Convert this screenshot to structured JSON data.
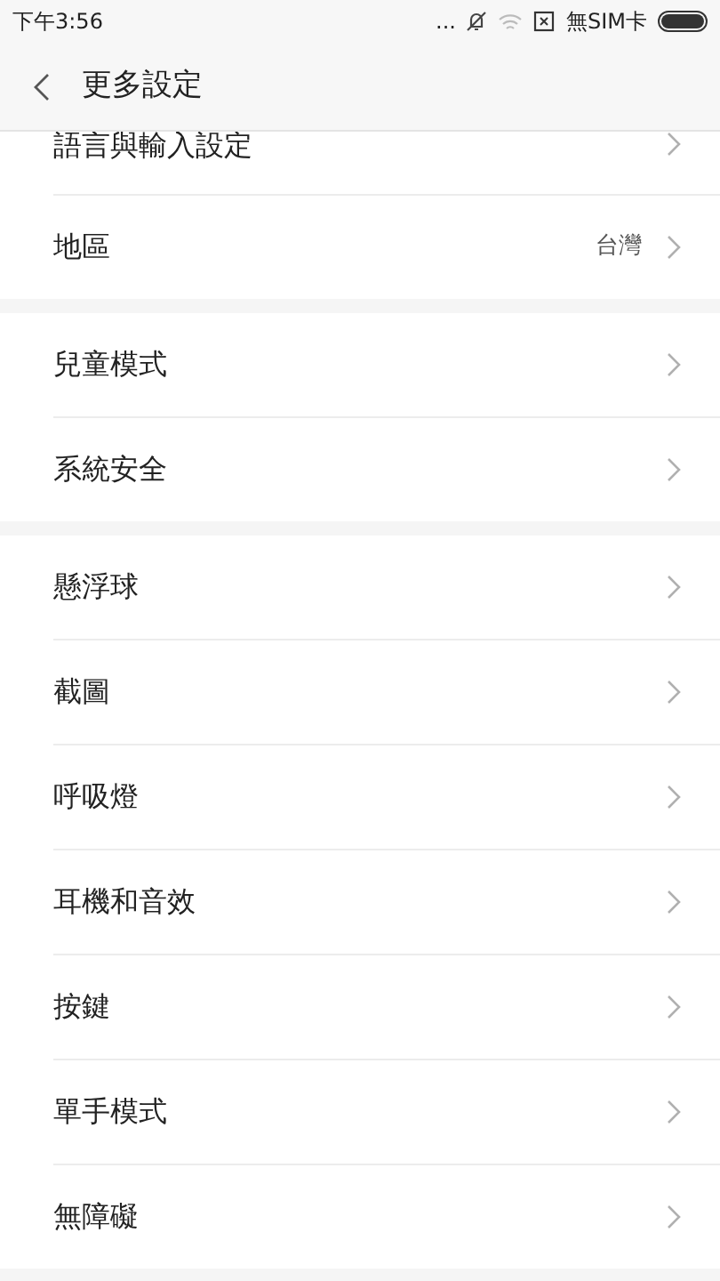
{
  "status_bar": {
    "time": "下午3:56",
    "dots": "...",
    "carrier": "無SIM卡"
  },
  "header": {
    "title": "更多設定"
  },
  "groups": [
    {
      "items": [
        {
          "label": "語言與輸入設定",
          "partial": true
        },
        {
          "label": "地區",
          "value": "台灣",
          "partial": false
        }
      ]
    },
    {
      "items": [
        {
          "label": "兒童模式",
          "partial": false
        },
        {
          "label": "系統安全",
          "partial": false
        }
      ]
    },
    {
      "items": [
        {
          "label": "懸浮球",
          "partial": false
        },
        {
          "label": "截圖",
          "partial": false
        },
        {
          "label": "呼吸燈",
          "partial": false
        },
        {
          "label": "耳機和音效",
          "partial": false
        },
        {
          "label": "按鍵",
          "partial": false
        },
        {
          "label": "單手模式",
          "partial": false
        },
        {
          "label": "無障礙",
          "partial": false
        }
      ]
    }
  ]
}
